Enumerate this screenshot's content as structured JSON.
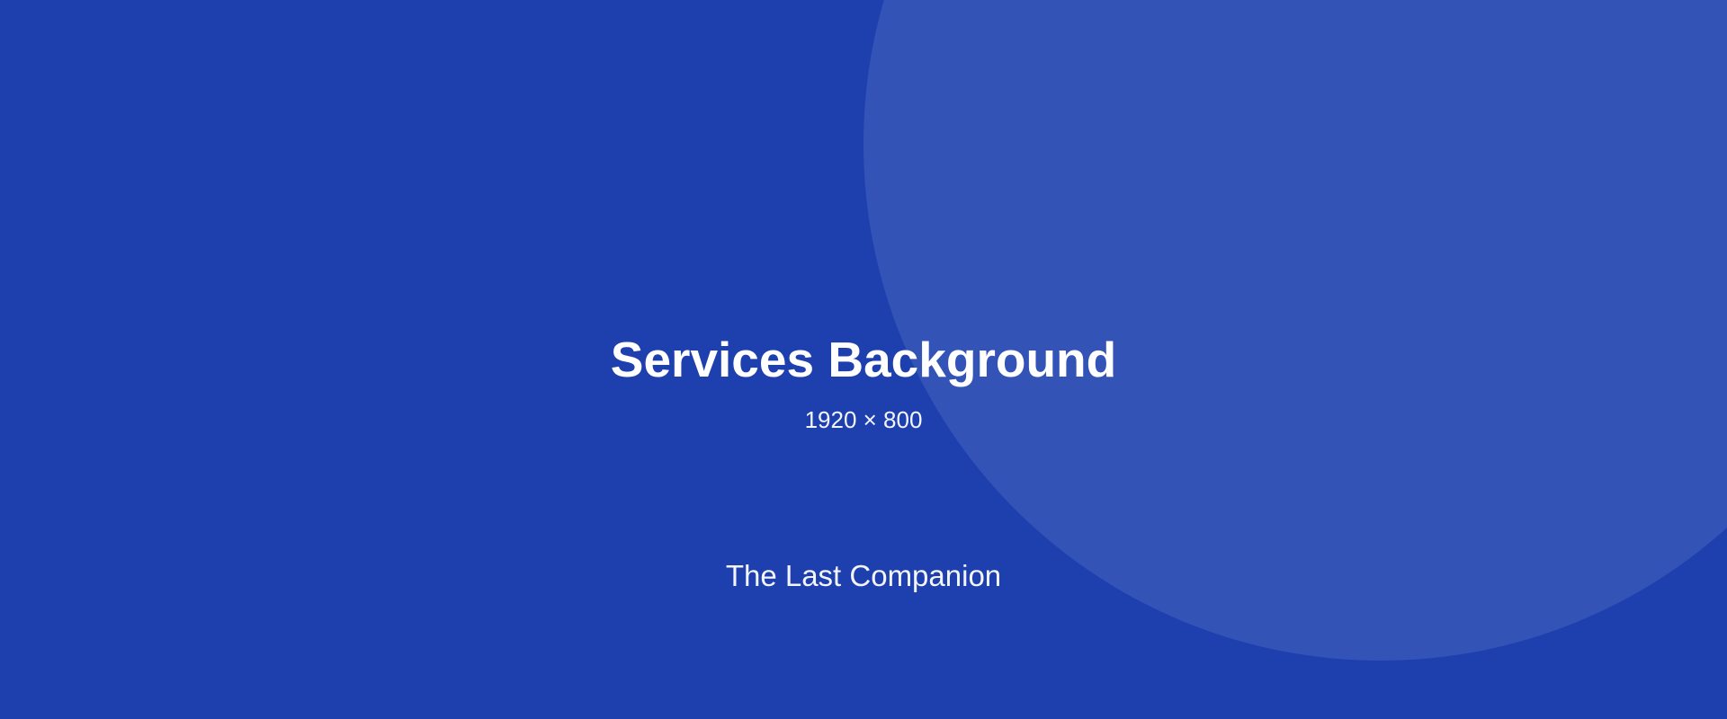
{
  "colors": {
    "background": "#1e40af",
    "decor_circle": "#ffffff",
    "text": "#ffffff"
  },
  "placeholder": {
    "title": "Services Background",
    "dimensions": "1920 × 800",
    "brand": "The Last Companion"
  }
}
